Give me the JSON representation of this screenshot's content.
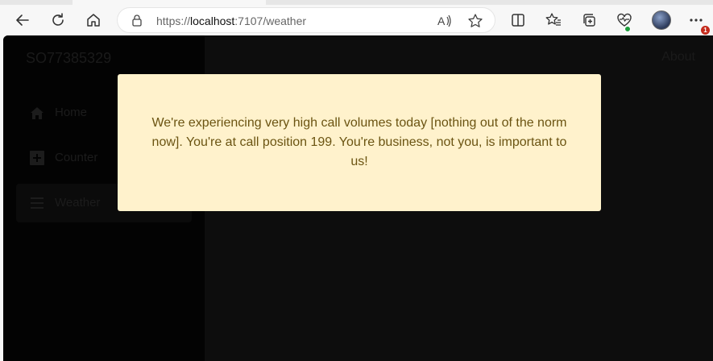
{
  "browser": {
    "url_scheme": "https://",
    "url_host": "localhost",
    "url_rest": ":7107/weather",
    "notification_count": "1"
  },
  "app": {
    "brand": "SO77385329",
    "about_label": "About",
    "nav": [
      {
        "label": "Home",
        "icon": "home-icon"
      },
      {
        "label": "Counter",
        "icon": "plus-icon"
      },
      {
        "label": "Weather",
        "icon": "list-icon"
      }
    ]
  },
  "modal": {
    "message": "We're experiencing very high call volumes today [nothing out of the norm now]. You're at call position 199. You're business, not you, is important to us!"
  },
  "colors": {
    "modal_background": "#fff2cc",
    "modal_text": "#6b5412",
    "page_background": "#0d0d0d",
    "sidebar_background": "#030303"
  }
}
